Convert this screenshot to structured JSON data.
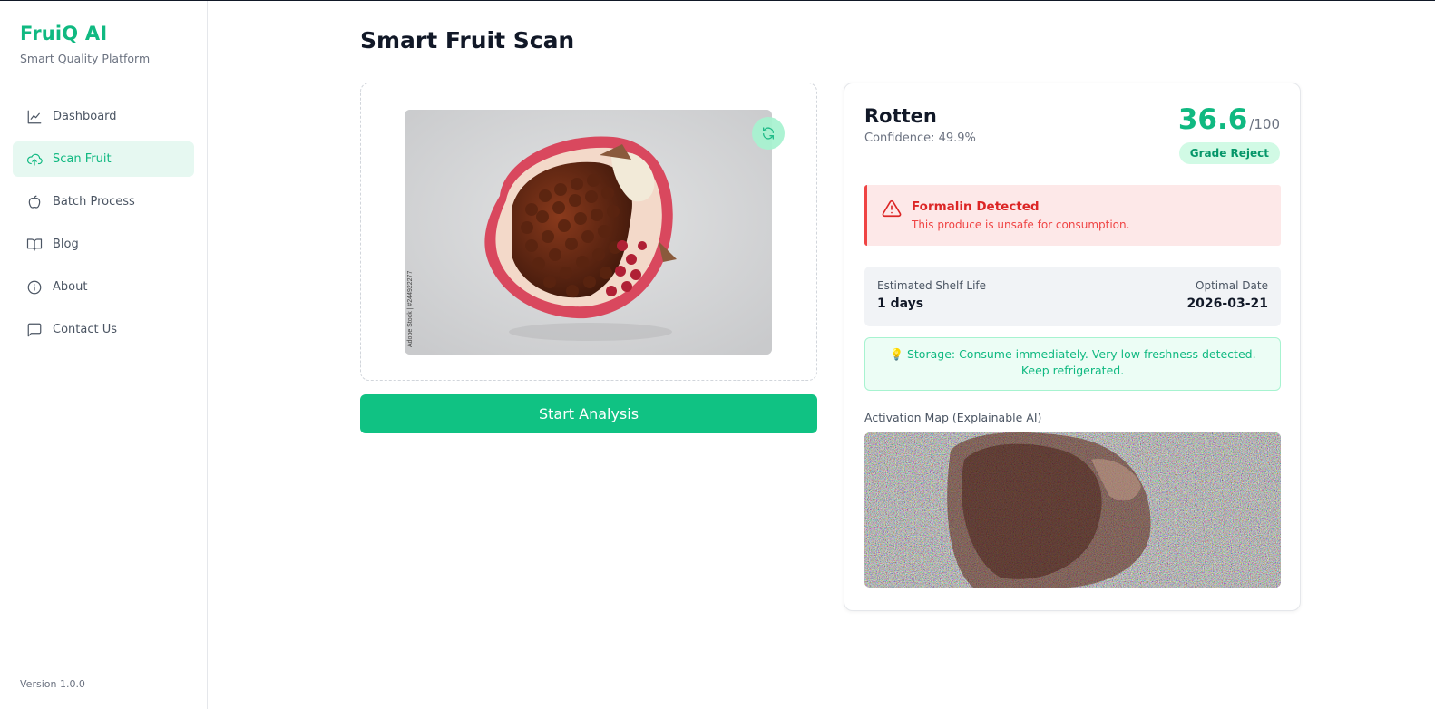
{
  "sidebar": {
    "brand": "FruiQ AI",
    "subtitle": "Smart Quality Platform",
    "items": [
      {
        "label": "Dashboard",
        "icon": "chart-line-icon"
      },
      {
        "label": "Scan Fruit",
        "icon": "cloud-upload-icon",
        "active": true
      },
      {
        "label": "Batch Process",
        "icon": "apple-icon"
      },
      {
        "label": "Blog",
        "icon": "book-open-icon"
      },
      {
        "label": "About",
        "icon": "info-icon"
      },
      {
        "label": "Contact Us",
        "icon": "message-square-icon"
      }
    ],
    "version": "Version 1.0.0"
  },
  "main": {
    "title": "Smart Fruit Scan",
    "upload": {
      "watermark": "Adobe Stock | #244922277"
    },
    "start_button": "Start Analysis"
  },
  "result": {
    "label": "Rotten",
    "confidence": "Confidence: 49.9%",
    "score": "36.6",
    "score_max": "/100",
    "grade": "Grade Reject",
    "alert": {
      "title": "Formalin Detected",
      "text": "This produce is unsafe for consumption."
    },
    "shelf_life": {
      "label": "Estimated Shelf Life",
      "value": "1 days",
      "date_label": "Optimal Date",
      "date_value": "2026-03-21"
    },
    "storage": "💡 Storage: Consume immediately. Very low freshness detected. Keep refrigerated.",
    "activation_map_label": "Activation Map (Explainable AI)"
  },
  "colors": {
    "accent": "#10b981",
    "button": "#10c283",
    "danger": "#ef4444",
    "active_bg": "#e6f8f1"
  }
}
